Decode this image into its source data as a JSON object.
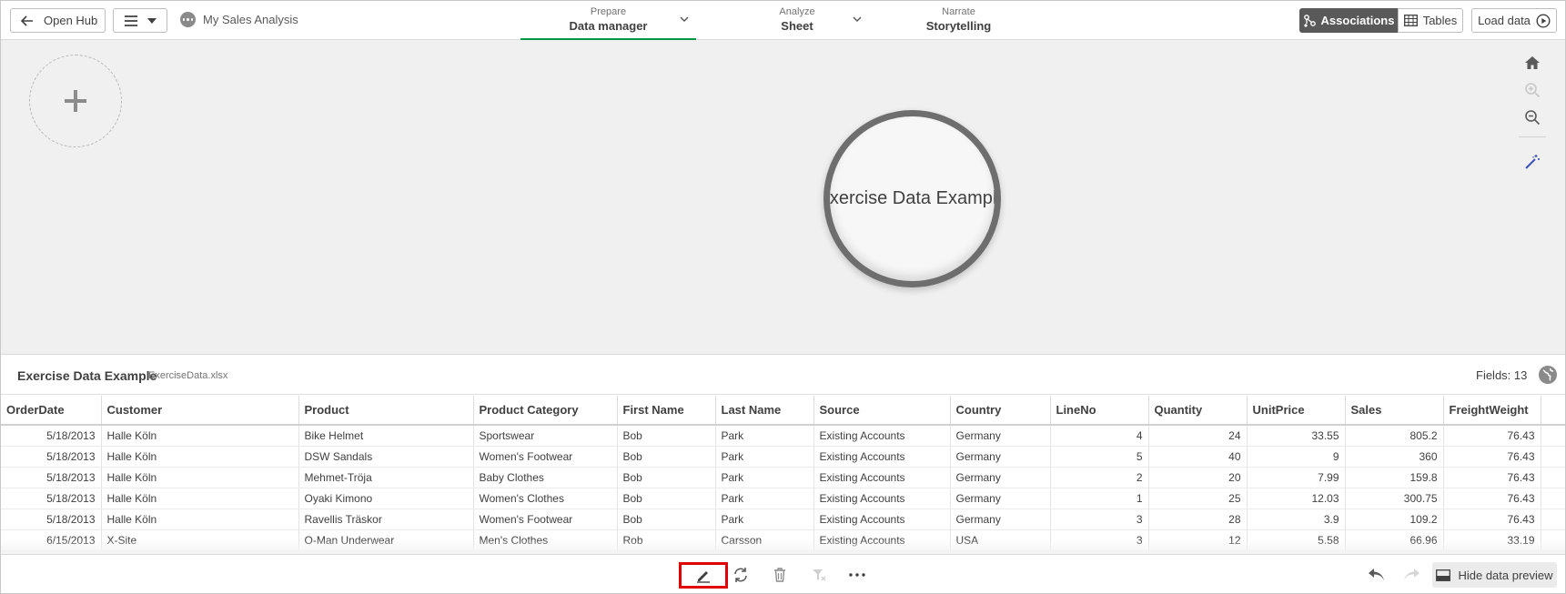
{
  "topbar": {
    "open_hub_label": "Open Hub",
    "app_name": "My Sales Analysis",
    "nav": [
      {
        "small": "Prepare",
        "big": "Data manager"
      },
      {
        "small": "Analyze",
        "big": "Sheet"
      },
      {
        "small": "Narrate",
        "big": "Storytelling"
      }
    ],
    "associations_label": "Associations",
    "tables_label": "Tables",
    "load_data_label": "Load data"
  },
  "canvas": {
    "bubble_label": "Exercise Data Example"
  },
  "preview": {
    "title": "Exercise Data Example",
    "file": "ExerciseData.xlsx",
    "fields": "Fields: 13",
    "columns": [
      "OrderDate",
      "Customer",
      "Product",
      "Product Category",
      "First Name",
      "Last Name",
      "Source",
      "Country",
      "LineNo",
      "Quantity",
      "UnitPrice",
      "Sales",
      "FreightWeight"
    ],
    "rows": [
      [
        "5/18/2013",
        "Halle Köln",
        "Bike Helmet",
        "Sportswear",
        "Bob",
        "Park",
        "Existing Accounts",
        "Germany",
        "4",
        "24",
        "33.55",
        "805.2",
        "76.43"
      ],
      [
        "5/18/2013",
        "Halle Köln",
        "DSW Sandals",
        "Women's Footwear",
        "Bob",
        "Park",
        "Existing Accounts",
        "Germany",
        "5",
        "40",
        "9",
        "360",
        "76.43"
      ],
      [
        "5/18/2013",
        "Halle Köln",
        "Mehmet-Tröja",
        "Baby Clothes",
        "Bob",
        "Park",
        "Existing Accounts",
        "Germany",
        "2",
        "20",
        "7.99",
        "159.8",
        "76.43"
      ],
      [
        "5/18/2013",
        "Halle Köln",
        "Oyaki Kimono",
        "Women's Clothes",
        "Bob",
        "Park",
        "Existing Accounts",
        "Germany",
        "1",
        "25",
        "12.03",
        "300.75",
        "76.43"
      ],
      [
        "5/18/2013",
        "Halle Köln",
        "Ravellis Träskor",
        "Women's Footwear",
        "Bob",
        "Park",
        "Existing Accounts",
        "Germany",
        "3",
        "28",
        "3.9",
        "109.2",
        "76.43"
      ],
      [
        "6/15/2013",
        "X-Site",
        "O-Man Underwear",
        "Men's Clothes",
        "Rob",
        "Carsson",
        "Existing Accounts",
        "USA",
        "3",
        "12",
        "5.58",
        "66.96",
        "33.19"
      ]
    ]
  },
  "bottombar": {
    "hide_preview_label": "Hide data preview"
  },
  "colors": {
    "active_tab": "#009845",
    "highlight": "#e00000",
    "associations_bg": "#595959"
  }
}
